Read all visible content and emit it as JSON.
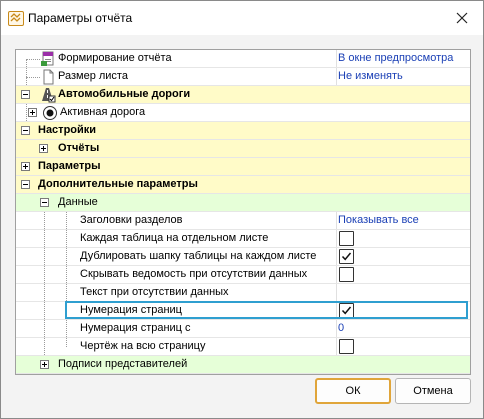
{
  "window": {
    "title": "Параметры отчёта"
  },
  "rows": [
    {
      "name": "Формирование отчёта",
      "value": "В окне предпросмотра"
    },
    {
      "name": "Размер листа",
      "value": "Не изменять"
    },
    {
      "name": "Автомобильные дороги"
    },
    {
      "name": "Активная дорога"
    },
    {
      "name": "Настройки"
    },
    {
      "name": "Отчёты"
    },
    {
      "name": "Параметры"
    },
    {
      "name": "Дополнительные параметры"
    },
    {
      "name": "Данные"
    },
    {
      "name": "Заголовки разделов",
      "value": "Показывать все"
    },
    {
      "name": "Каждая таблица на отдельном листе",
      "checked": false
    },
    {
      "name": "Дублировать шапку таблицы на каждом листе",
      "checked": true
    },
    {
      "name": "Скрывать ведомость при отсутствии данных",
      "checked": false
    },
    {
      "name": "Текст при отсутствии данных",
      "value": ""
    },
    {
      "name": "Нумерация страниц",
      "checked": true
    },
    {
      "name": "Нумерация страниц с",
      "value": "0"
    },
    {
      "name": "Чертёж на всю страницу",
      "checked": false
    },
    {
      "name": "Подписи представителей"
    }
  ],
  "buttons": {
    "ok": "ОК",
    "cancel": "Отмена"
  },
  "colors": {
    "category_bg": "#fffbc8",
    "subcategory_bg": "#e6ffd8",
    "value_text": "#1a3fb5",
    "selection_outline": "#2f9fd0",
    "default_button_border": "#e0a53a"
  }
}
